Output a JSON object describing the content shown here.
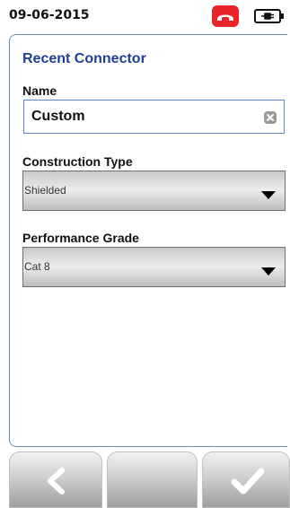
{
  "status": {
    "date": "09-06-2015",
    "phone_icon": "phone-hangup-icon",
    "battery_icon": "battery-plug-icon",
    "phone_color": "#e8232a"
  },
  "panel": {
    "title": "Recent Connector",
    "name": {
      "label": "Name",
      "value": "Custom"
    },
    "construction_type": {
      "label": "Construction Type",
      "selected": "Shielded"
    },
    "performance_grade": {
      "label": "Performance Grade",
      "selected": "Cat 8"
    }
  },
  "toolbar": {
    "back_icon": "chevron-left-icon",
    "confirm_icon": "checkmark-icon"
  },
  "colors": {
    "title": "#1f3f95",
    "panel_border": "#6a8fc8"
  }
}
